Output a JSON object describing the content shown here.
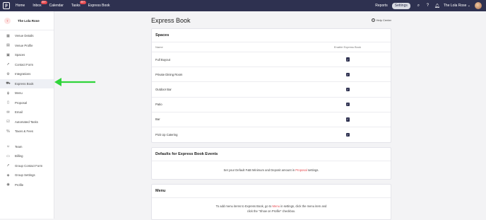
{
  "topbar": {
    "nav": [
      {
        "label": "Home",
        "badge": ""
      },
      {
        "label": "Inbox",
        "badge": "99+"
      },
      {
        "label": "Calendar",
        "badge": ""
      },
      {
        "label": "Tasks",
        "badge": "99+"
      },
      {
        "label": "Express Book",
        "badge": ""
      }
    ],
    "reports_label": "Reports",
    "settings_label": "Settings",
    "venue_name": "The Lola Rose"
  },
  "sidebar": {
    "venue_name": "The Lola Rose",
    "venue_initial": "T",
    "items": [
      {
        "label": "Venue Details",
        "icon": "building-icon",
        "glyph": "▦",
        "active": false
      },
      {
        "label": "Venue Profile",
        "icon": "profile-card-icon",
        "glyph": "▤",
        "active": false
      },
      {
        "label": "Spaces",
        "icon": "grid-icon",
        "glyph": "▣",
        "active": false
      },
      {
        "label": "Contact Form",
        "icon": "cursor-icon",
        "glyph": "➚",
        "active": false
      },
      {
        "label": "Integrations",
        "icon": "gear-icon",
        "glyph": "⚙",
        "active": false
      },
      {
        "label": "Express Book",
        "icon": "cart-icon",
        "glyph": "⛟",
        "active": true
      },
      {
        "label": "Menu",
        "icon": "utensils-icon",
        "glyph": "ψ",
        "active": false
      },
      {
        "label": "Proposal",
        "icon": "document-icon",
        "glyph": "▯",
        "active": false
      },
      {
        "label": "Email",
        "icon": "envelope-icon",
        "glyph": "✉",
        "active": false
      },
      {
        "label": "Automated Tasks",
        "icon": "checklist-icon",
        "glyph": "☑",
        "active": false
      },
      {
        "label": "Taxes & Fees",
        "icon": "percent-icon",
        "glyph": "%",
        "active": false
      }
    ],
    "items2": [
      {
        "label": "Team",
        "icon": "team-icon",
        "glyph": "☺",
        "active": false
      },
      {
        "label": "Billing",
        "icon": "credit-card-icon",
        "glyph": "▭",
        "active": false
      },
      {
        "label": "Group Contact Form",
        "icon": "cursor-icon",
        "glyph": "➚",
        "active": false
      },
      {
        "label": "Group Settings",
        "icon": "layers-icon",
        "glyph": "◈",
        "active": false
      },
      {
        "label": "Profile",
        "icon": "user-circle-icon",
        "glyph": "◉",
        "active": false
      }
    ]
  },
  "main": {
    "title": "Express Book",
    "help_label": "Help Center",
    "spaces_card": {
      "title": "Spaces",
      "col_name": "Name",
      "col_enable": "Enable Express Book",
      "rows": [
        {
          "name": "Full Buyout",
          "enabled": true
        },
        {
          "name": "Private Dining Room",
          "enabled": true
        },
        {
          "name": "Outdoor Bar",
          "enabled": true
        },
        {
          "name": "Patio",
          "enabled": true
        },
        {
          "name": "Bar",
          "enabled": true
        },
        {
          "name": "Pick Up Catering",
          "enabled": true
        }
      ]
    },
    "defaults_card": {
      "title": "Defaults for Express Book Events",
      "text_before": "Set your Default F&B Minimum and Deposit amount in ",
      "link": "Proposal",
      "text_after": " settings."
    },
    "menu_card": {
      "title": "Menu",
      "text_before": "To add menu items to Express Book, go to ",
      "link": "Menu",
      "text_after": " in settings, click the menu item and click the \"Show on Profile\" checkbox."
    }
  },
  "colors": {
    "topbar": "#2e3150",
    "accent": "#e5484d",
    "arrow": "#2fd43a"
  }
}
